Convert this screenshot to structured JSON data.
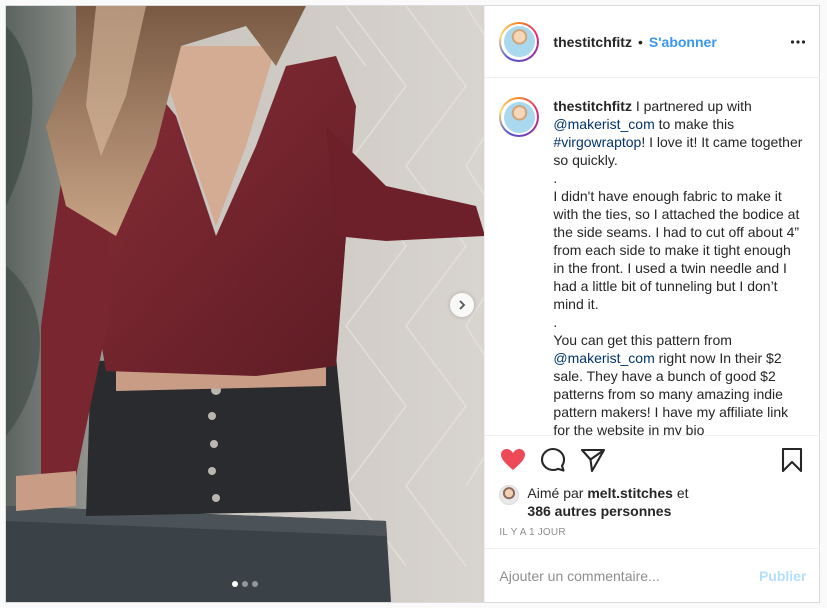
{
  "header": {
    "username": "thestitchfitz",
    "separator": "•",
    "follow_label": "S'abonner"
  },
  "caption": {
    "username": "thestitchfitz",
    "lines": [
      "I partnered up with",
      "to make this",
      "! I love it! It came together so quickly.",
      ".",
      "I didn't have enough fabric to make it with the ties, so I attached the bodice at the side seams. I had to cut off about 4” from each side to make it tight enough in the front. I used a twin needle and I had a little bit of tunneling but I don’t mind it.",
      ".",
      "You can get this pattern from",
      "right now In their $2 sale. They have a bunch of good $2 patterns from so many amazing indie pattern makers! I have my affiliate link for the website in my bio"
    ],
    "mention1": "@makerist_com",
    "hashtag": "#virgowraptop",
    "mention2": "@makerist_com"
  },
  "likes": {
    "prefix": "Aimé par",
    "user": "melt.stitches",
    "and": "et",
    "others": "386 autres personnes"
  },
  "timestamp": "IL Y A 1 JOUR",
  "comment_box": {
    "placeholder": "Ajouter un commentaire...",
    "publish_label": "Publier"
  },
  "colors": {
    "like": "#ed4956",
    "accent": "#3897f0",
    "publish_disabled": "#b2dffc",
    "top_maroon": "#7a2630"
  },
  "carousel": {
    "count": 3,
    "active_index": 0
  }
}
